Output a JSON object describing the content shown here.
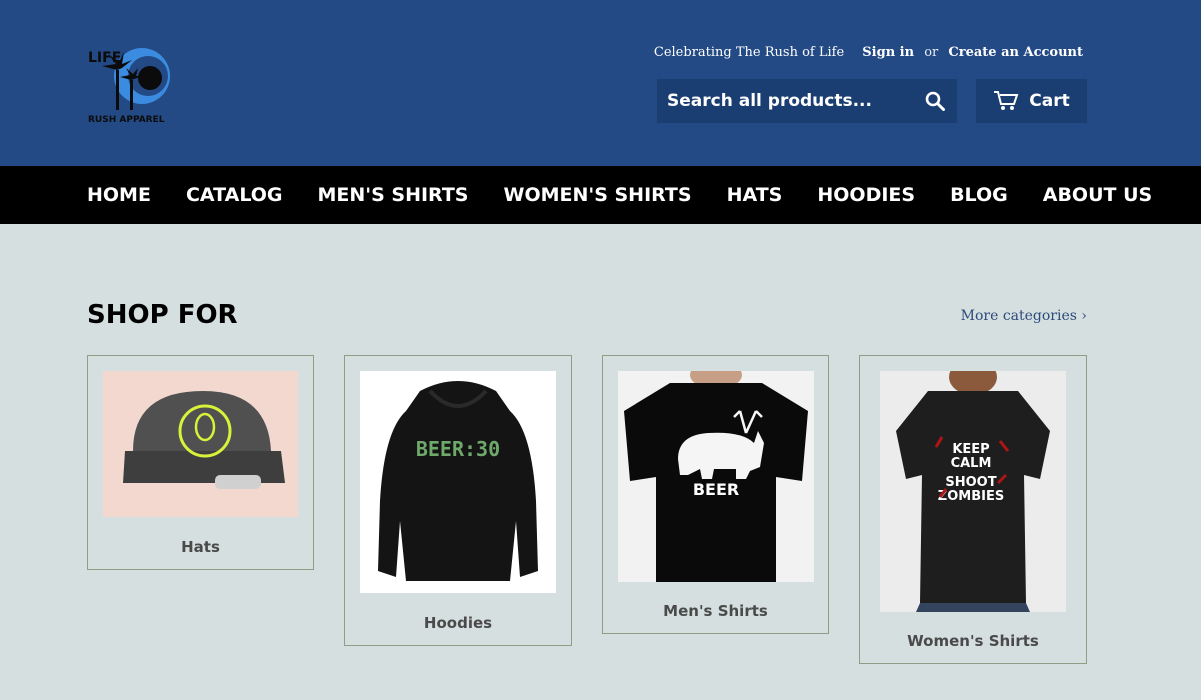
{
  "header": {
    "logo_text_vertical": "LIFE",
    "logo_text_bottom": "RUSH APPAREL",
    "tagline": "Celebrating The Rush of Life",
    "sign_in": "Sign in",
    "or": "or",
    "create_account": "Create an Account",
    "search_placeholder": "Search all products...",
    "cart_label": "Cart"
  },
  "nav": {
    "items": [
      "HOME",
      "CATALOG",
      "MEN'S SHIRTS",
      "WOMEN'S SHIRTS",
      "HATS",
      "HOODIES",
      "BLOG",
      "ABOUT US"
    ]
  },
  "section": {
    "title": "SHOP FOR",
    "more_link": "More categories ›"
  },
  "categories": [
    {
      "label": "Hats"
    },
    {
      "label": "Hoodies"
    },
    {
      "label": "Men's Shirts",
      "graphic_text": "BEER"
    },
    {
      "label": "Women's Shirts",
      "graphic_lines": [
        "KEEP",
        "CALM",
        "SHOOT",
        "ZOMBIES"
      ]
    }
  ],
  "hoodie_graphic_text": "BEER:30",
  "colors": {
    "header_bg": "#234a84",
    "nav_bg": "#000000",
    "page_bg": "#d6dfe0",
    "accent": "#3b8be0"
  }
}
